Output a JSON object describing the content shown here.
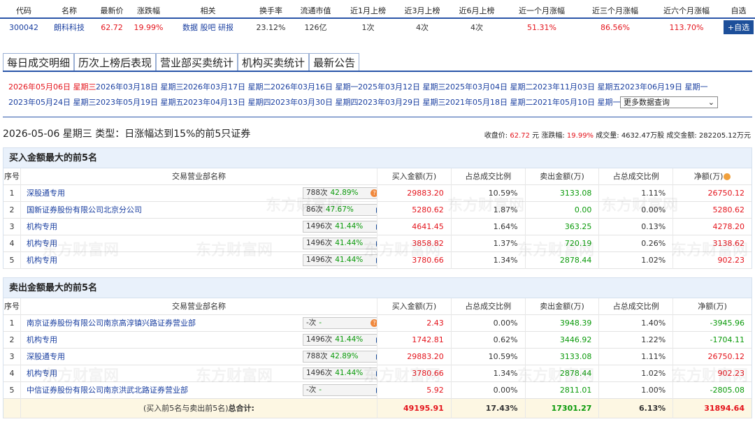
{
  "quote": {
    "headers": [
      "代码",
      "名称",
      "最新价",
      "涨跌幅",
      "相关",
      "换手率",
      "流通市值",
      "近1月上榜",
      "近3月上榜",
      "近6月上榜",
      "近一个月涨幅",
      "近三个月涨幅",
      "近六个月涨幅",
      "自选"
    ],
    "code": "300042",
    "name": "朗科科技",
    "price": "62.72",
    "change": "19.99%",
    "related": [
      "数据",
      "股吧",
      "研报"
    ],
    "turnover": "23.12%",
    "market_cap": "126亿",
    "m1": "1次",
    "m3": "4次",
    "m6": "4次",
    "gain_1m": "51.31%",
    "gain_3m": "86.56%",
    "gain_6m": "113.70%",
    "add_label": "+自选"
  },
  "tabs": [
    "每日成交明细",
    "历次上榜后表现",
    "营业部买卖统计",
    "机构买卖统计",
    "最新公告"
  ],
  "dates": {
    "row1": [
      "2026年05月06日 星期三",
      "2026年03月18日 星期三",
      "2026年03月17日 星期二",
      "2026年03月16日 星期一",
      "2025年03月12日 星期三",
      "2025年03月04日 星期二",
      "2023年11月03日 星期五",
      "2023年06月19日 星期一"
    ],
    "row2": [
      "2023年05月24日 星期三",
      "2023年05月19日 星期五",
      "2023年04月13日 星期四",
      "2023年03月30日 星期四",
      "2023年03月29日 星期三",
      "2021年05月18日 星期二",
      "2021年05月10日 星期一"
    ],
    "more_label": "更多数据查询"
  },
  "summary": {
    "title": "2026-05-06 星期三 类型：日涨幅达到15%的前5只证券",
    "close_label": "收盘价:",
    "close": "62.72",
    "close_unit": "元",
    "chg_label": "涨跌幅:",
    "chg": "19.99%",
    "vol_label": "成交量:",
    "vol": "4632.47万股",
    "amt_label": "成交金额:",
    "amt": "282205.12万元"
  },
  "col_headers": [
    "序号",
    "交易营业部名称",
    "买入金额(万)",
    "占总成交比例",
    "卖出金额(万)",
    "占总成交比例",
    "净额(万)"
  ],
  "buy": {
    "title": "买入金额最大的前5名",
    "rows": [
      {
        "idx": "1",
        "name": "深股通专用",
        "cnt": "788次",
        "pct": "42.89%",
        "dot": true,
        "buy": "29883.20",
        "bp": "10.59%",
        "sell": "3133.08",
        "sp": "1.11%",
        "net": "26750.12",
        "neg": false
      },
      {
        "idx": "2",
        "name": "国新证券股份有限公司北京分公司",
        "cnt": "86次",
        "pct": "47.67%",
        "dot": false,
        "buy": "5280.62",
        "bp": "1.87%",
        "sell": "0.00",
        "sp": "0.00%",
        "net": "5280.62",
        "neg": false
      },
      {
        "idx": "3",
        "name": "机构专用",
        "cnt": "1496次",
        "pct": "41.44%",
        "dot": false,
        "buy": "4641.45",
        "bp": "1.64%",
        "sell": "363.25",
        "sp": "0.13%",
        "net": "4278.20",
        "neg": false
      },
      {
        "idx": "4",
        "name": "机构专用",
        "cnt": "1496次",
        "pct": "41.44%",
        "dot": false,
        "buy": "3858.82",
        "bp": "1.37%",
        "sell": "720.19",
        "sp": "0.26%",
        "net": "3138.62",
        "neg": false
      },
      {
        "idx": "5",
        "name": "机构专用",
        "cnt": "1496次",
        "pct": "41.44%",
        "dot": false,
        "buy": "3780.66",
        "bp": "1.34%",
        "sell": "2878.44",
        "sp": "1.02%",
        "net": "902.23",
        "neg": false
      }
    ]
  },
  "sell": {
    "title": "卖出金额最大的前5名",
    "rows": [
      {
        "idx": "1",
        "name": "南京证券股份有限公司南京高淳镇兴路证券营业部",
        "cnt": "-次",
        "pct": "-",
        "dot": true,
        "buy": "2.43",
        "bp": "0.00%",
        "sell": "3948.39",
        "sp": "1.40%",
        "net": "-3945.96",
        "neg": true
      },
      {
        "idx": "2",
        "name": "机构专用",
        "cnt": "1496次",
        "pct": "41.44%",
        "dot": false,
        "buy": "1742.81",
        "bp": "0.62%",
        "sell": "3446.92",
        "sp": "1.22%",
        "net": "-1704.11",
        "neg": true
      },
      {
        "idx": "3",
        "name": "深股通专用",
        "cnt": "788次",
        "pct": "42.89%",
        "dot": false,
        "buy": "29883.20",
        "bp": "10.59%",
        "sell": "3133.08",
        "sp": "1.11%",
        "net": "26750.12",
        "neg": false
      },
      {
        "idx": "4",
        "name": "机构专用",
        "cnt": "1496次",
        "pct": "41.44%",
        "dot": false,
        "buy": "3780.66",
        "bp": "1.34%",
        "sell": "2878.44",
        "sp": "1.02%",
        "net": "902.23",
        "neg": false
      },
      {
        "idx": "5",
        "name": "中信证券股份有限公司南京洪武北路证券营业部",
        "cnt": "-次",
        "pct": "-",
        "dot": false,
        "buy": "5.92",
        "bp": "0.00%",
        "sell": "2811.01",
        "sp": "1.00%",
        "net": "-2805.08",
        "neg": true
      }
    ]
  },
  "total": {
    "label_a": "(买入前5名与卖出前5名)",
    "label_b": "总合计:",
    "buy": "49195.91",
    "bp": "17.43%",
    "sell": "17301.27",
    "sp": "6.13%",
    "net": "31894.64"
  },
  "watermark": "东方财富网",
  "colors": {
    "up": "#e4141c",
    "down": "#0a9a0a",
    "link": "#1a3fa0",
    "accent": "#2a55a8"
  }
}
